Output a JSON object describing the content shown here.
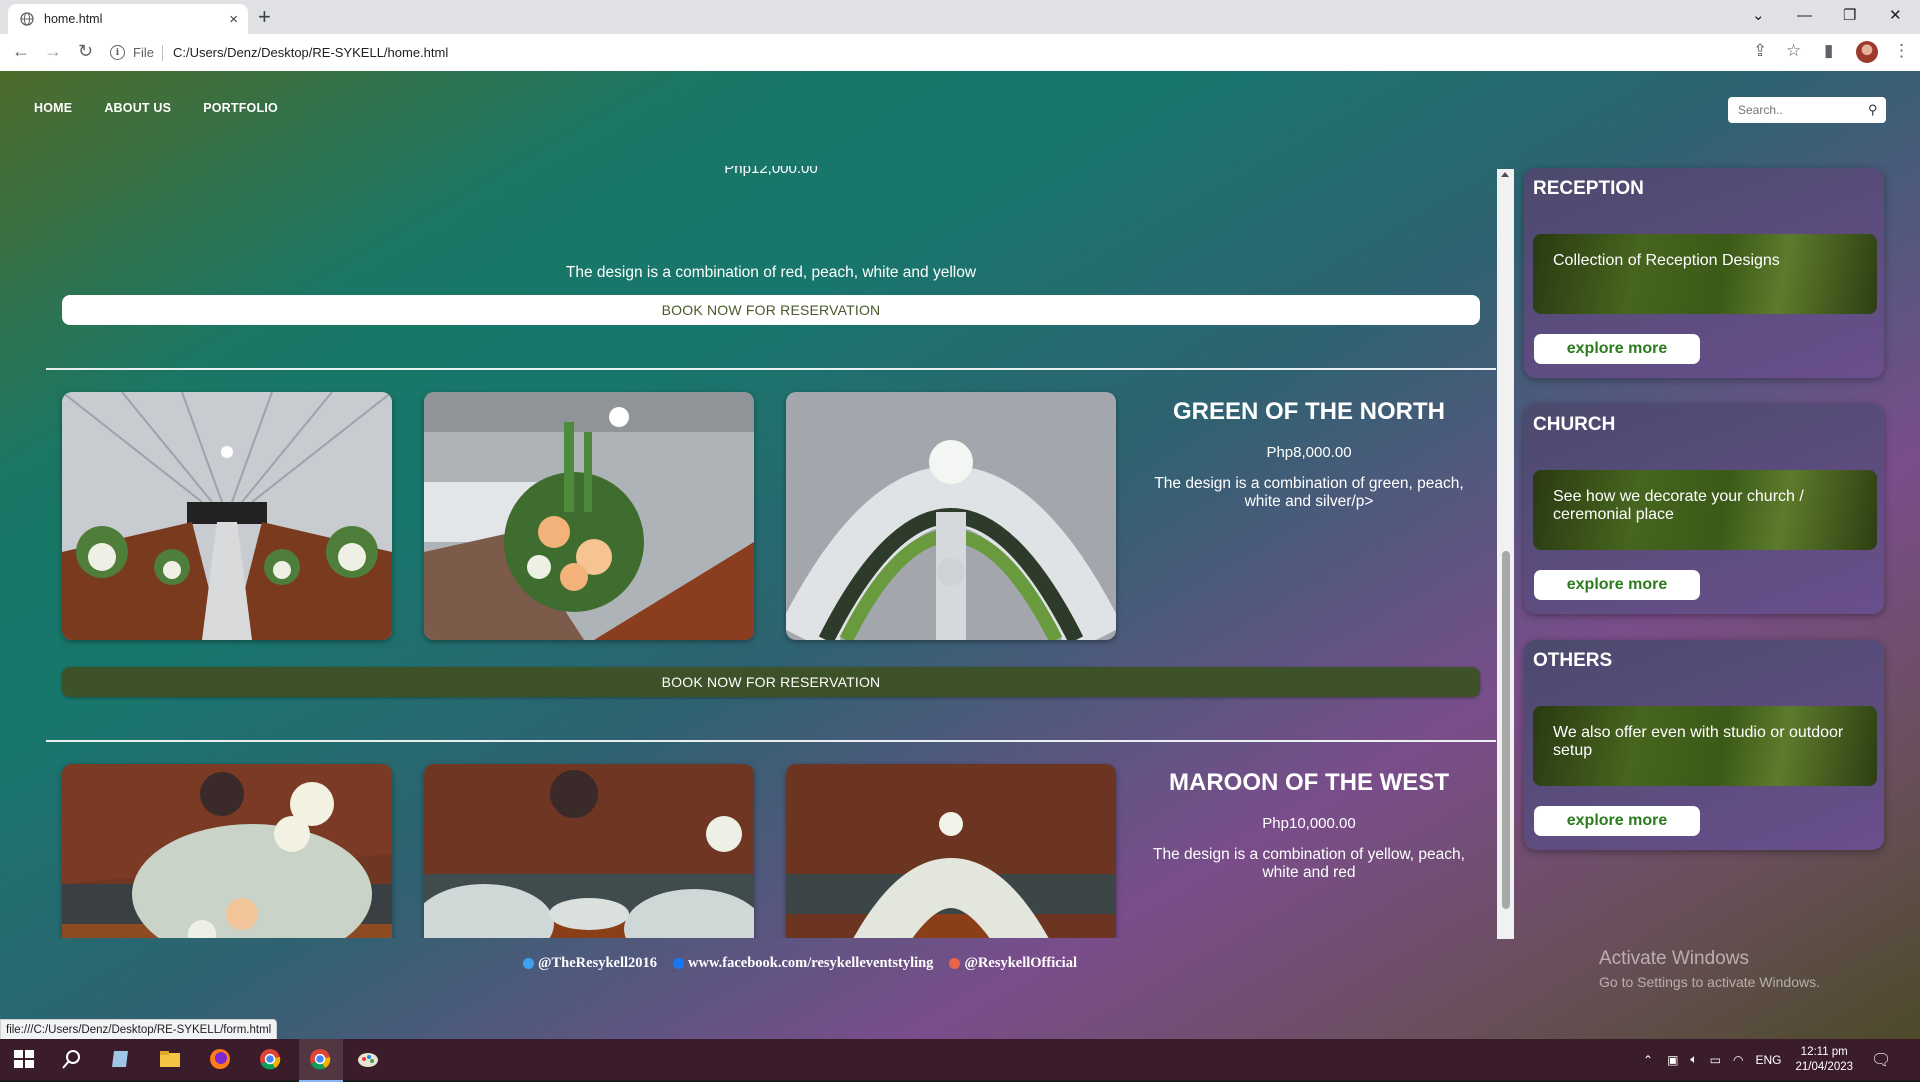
{
  "browser": {
    "tab_title": "home.html",
    "tab_close": "×",
    "new_tab": "+",
    "file_label": "File",
    "url": "C:/Users/Denz/Desktop/RE-SYKELL/home.html",
    "status_url": "file:///C:/Users/Denz/Desktop/RE-SYKELL/form.html"
  },
  "nav": {
    "items": [
      "HOME",
      "ABOUT US",
      "PORTFOLIO"
    ],
    "search_placeholder": "Search.."
  },
  "main": {
    "partial": {
      "price": "Php12,000.00",
      "description": "The design is a combination of red, peach, white and yellow",
      "book_label": "BOOK NOW FOR RESERVATION"
    },
    "products": [
      {
        "title": "GREEN OF THE NORTH",
        "price": "Php8,000.00",
        "description": "The design is a combination of green, peach, white and silver/p>",
        "book_label": "BOOK NOW FOR RESERVATION",
        "photos": [
          "church-aisle-flowers",
          "church-pews-flower-arrangement",
          "greenery-arch"
        ]
      },
      {
        "title": "MAROON OF THE WEST",
        "price": "Php10,000.00",
        "description": "The design is a combination of yellow, peach, white and red",
        "photos": [
          "white-orchid-arrangement",
          "white-floral-aisle",
          "floral-arch-aisle"
        ]
      }
    ]
  },
  "sidebar": {
    "cards": [
      {
        "heading": "RECEPTION",
        "banner": "Collection of Reception Designs",
        "button": "explore more"
      },
      {
        "heading": "CHURCH",
        "banner": "See how we decorate your church / ceremonial place",
        "button": "explore more"
      },
      {
        "heading": "OTHERS",
        "banner": "We also offer even with studio or outdoor setup",
        "button": "explore more"
      }
    ]
  },
  "footer": {
    "twitter": "@TheResykell2016",
    "facebook": "www.facebook.com/resykelleventstyling",
    "instagram": "@ResykellOfficial"
  },
  "watermark": {
    "line1": "Activate Windows",
    "line2": "Go to Settings to activate Windows."
  },
  "taskbar": {
    "language": "ENG",
    "time": "12:11 pm",
    "date": "21/04/2023"
  },
  "colors": {
    "book_dark": "#3e5229",
    "explore_text": "#2c7b1c",
    "taskbar": "#3b1c2a"
  }
}
